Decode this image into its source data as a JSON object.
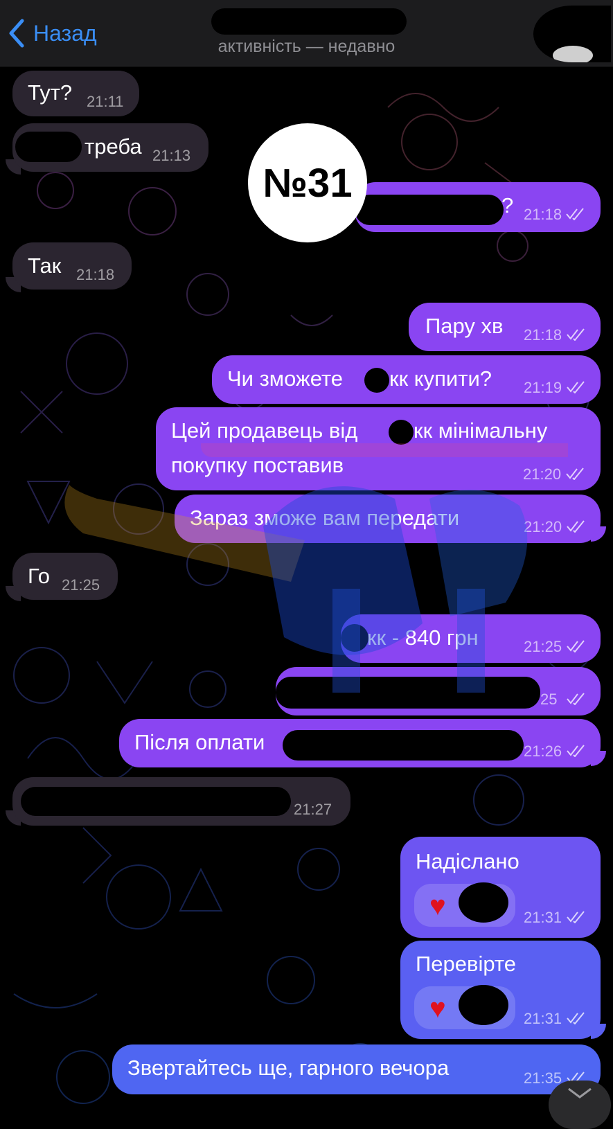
{
  "header": {
    "back_label": "Назад",
    "status": "активність — недавно"
  },
  "badge": "№31",
  "messages": [
    {
      "text": "Тут?",
      "time": "21:11"
    },
    {
      "text": "треба",
      "time": "21:13"
    },
    {
      "text": "?",
      "time": "21:18"
    },
    {
      "text": "Так",
      "time": "21:18"
    },
    {
      "text": "Пару хв",
      "time": "21:18"
    },
    {
      "text": "Чи зможете",
      "text2": "кк купити?",
      "time": "21:19"
    },
    {
      "text": "Цей продавець від",
      "text2": "кк мінімальну",
      "text3": "покупку поставив",
      "time": "21:20"
    },
    {
      "text": "Зараз зможе вам передати",
      "time": "21:20"
    },
    {
      "text": "Го",
      "time": "21:25"
    },
    {
      "text": "кк - 840 грн",
      "time": "21:25"
    },
    {
      "text": "",
      "time": "25"
    },
    {
      "text": "Після оплати",
      "time": "21:26"
    },
    {
      "text": "",
      "time": "21:27"
    },
    {
      "text": "Надіслано",
      "time": "21:31"
    },
    {
      "text": "Перевірте",
      "time": "21:31"
    },
    {
      "text": "Звертайтесь ще, гарного вечора",
      "time": "21:35"
    }
  ],
  "colors": {
    "incoming": "#2b2530",
    "outgoing_top": "#8a45f2",
    "outgoing_bottom": "#4f66f2",
    "link": "#3a8ef6"
  }
}
